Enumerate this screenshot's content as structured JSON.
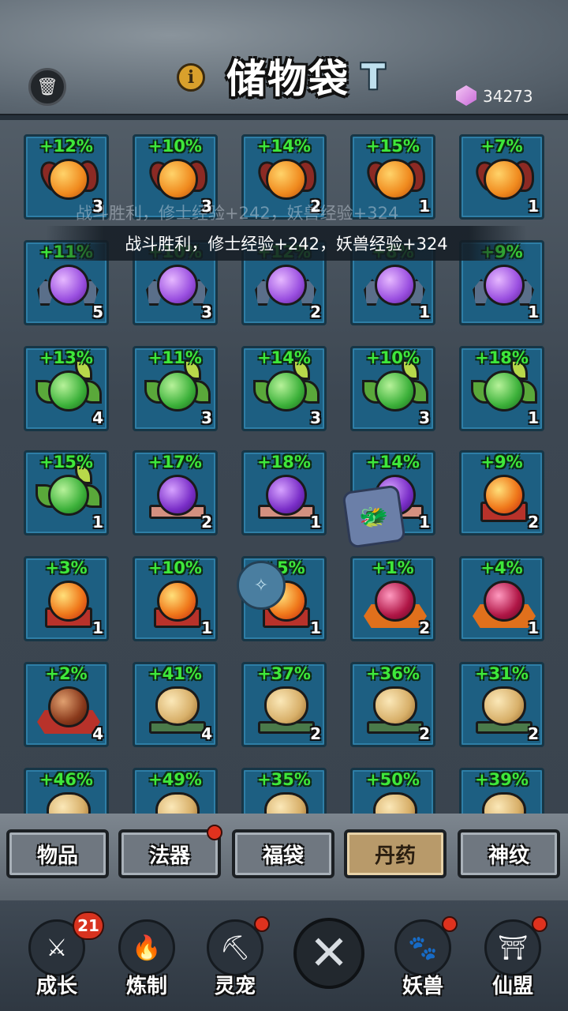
{
  "header": {
    "title": "储物袋",
    "currency_value": "34273",
    "icons": {
      "trash": "trash-icon",
      "info": "info-icon",
      "sort": "sort-icon",
      "gem": "gem-icon"
    }
  },
  "toast": {
    "ghost_message": "战斗胜利，修士经验+242，妖兽经验+324",
    "message": "战斗胜利，修士经验+242，妖兽经验+324"
  },
  "grid": {
    "rows": [
      [
        {
          "pct": "+12%",
          "qty": "3",
          "kind": "flower-orange"
        },
        {
          "pct": "+10%",
          "qty": "3",
          "kind": "flower-orange"
        },
        {
          "pct": "+14%",
          "qty": "2",
          "kind": "flower-orange"
        },
        {
          "pct": "+15%",
          "qty": "1",
          "kind": "flower-orange"
        },
        {
          "pct": "+7%",
          "qty": "1",
          "kind": "flower-orange"
        }
      ],
      [
        {
          "pct": "+11%",
          "qty": "5",
          "kind": "crystal-purple"
        },
        {
          "pct": "+10%",
          "qty": "3",
          "kind": "crystal-purple"
        },
        {
          "pct": "+12%",
          "qty": "2",
          "kind": "crystal-purple"
        },
        {
          "pct": "+8%",
          "qty": "1",
          "kind": "crystal-purple"
        },
        {
          "pct": "+9%",
          "qty": "1",
          "kind": "crystal-purple"
        }
      ],
      [
        {
          "pct": "+13%",
          "qty": "4",
          "kind": "leaf-green"
        },
        {
          "pct": "+11%",
          "qty": "3",
          "kind": "leaf-green"
        },
        {
          "pct": "+14%",
          "qty": "3",
          "kind": "leaf-green"
        },
        {
          "pct": "+10%",
          "qty": "3",
          "kind": "leaf-green"
        },
        {
          "pct": "+18%",
          "qty": "1",
          "kind": "leaf-green"
        }
      ],
      [
        {
          "pct": "+15%",
          "qty": "1",
          "kind": "leaf-green"
        },
        {
          "pct": "+17%",
          "qty": "2",
          "kind": "cushion-purple"
        },
        {
          "pct": "+18%",
          "qty": "1",
          "kind": "cushion-purple"
        },
        {
          "pct": "+14%",
          "qty": "1",
          "kind": "cushion-purple"
        },
        {
          "pct": "+9%",
          "qty": "2",
          "kind": "altar-fire"
        }
      ],
      [
        {
          "pct": "+3%",
          "qty": "1",
          "kind": "altar-fire"
        },
        {
          "pct": "+10%",
          "qty": "1",
          "kind": "altar-fire"
        },
        {
          "pct": "+5%",
          "qty": "1",
          "kind": "altar-fire"
        },
        {
          "pct": "+1%",
          "qty": "2",
          "kind": "hex-crimson"
        },
        {
          "pct": "+4%",
          "qty": "1",
          "kind": "hex-crimson"
        }
      ],
      [
        {
          "pct": "+2%",
          "qty": "4",
          "kind": "hex-brown"
        },
        {
          "pct": "+41%",
          "qty": "4",
          "kind": "egg-gold"
        },
        {
          "pct": "+37%",
          "qty": "2",
          "kind": "egg-gold"
        },
        {
          "pct": "+36%",
          "qty": "2",
          "kind": "egg-gold"
        },
        {
          "pct": "+31%",
          "qty": "2",
          "kind": "egg-gold"
        }
      ],
      [
        {
          "pct": "+46%",
          "qty": "",
          "kind": "egg-gold"
        },
        {
          "pct": "+49%",
          "qty": "",
          "kind": "egg-gold"
        },
        {
          "pct": "+35%",
          "qty": "",
          "kind": "egg-gold"
        },
        {
          "pct": "+50%",
          "qty": "",
          "kind": "egg-gold"
        },
        {
          "pct": "+39%",
          "qty": "",
          "kind": "egg-gold"
        }
      ]
    ]
  },
  "tabs": [
    {
      "label": "物品",
      "active": false,
      "dot": false
    },
    {
      "label": "法器",
      "active": false,
      "dot": true
    },
    {
      "label": "福袋",
      "active": false,
      "dot": false
    },
    {
      "label": "丹药",
      "active": true,
      "dot": false
    },
    {
      "label": "神纹",
      "active": false,
      "dot": false
    }
  ],
  "nav": [
    {
      "label": "成长",
      "badge": "21",
      "dot": false,
      "icon": "sword-icon"
    },
    {
      "label": "炼制",
      "badge": "",
      "dot": false,
      "icon": "furnace-icon"
    },
    {
      "label": "灵宠",
      "badge": "",
      "dot": true,
      "icon": "pickaxe-icon"
    },
    {
      "label": "妖兽",
      "badge": "",
      "dot": true,
      "icon": "beast-icon"
    },
    {
      "label": "仙盟",
      "badge": "",
      "dot": true,
      "icon": "pagoda-icon"
    }
  ],
  "close_icon": "close-icon",
  "colors": {
    "pct_green": "#3ee83a",
    "slot_blue": "#1d5f82",
    "active_tab": "#b89a6a",
    "red_dot": "#e0321e"
  }
}
